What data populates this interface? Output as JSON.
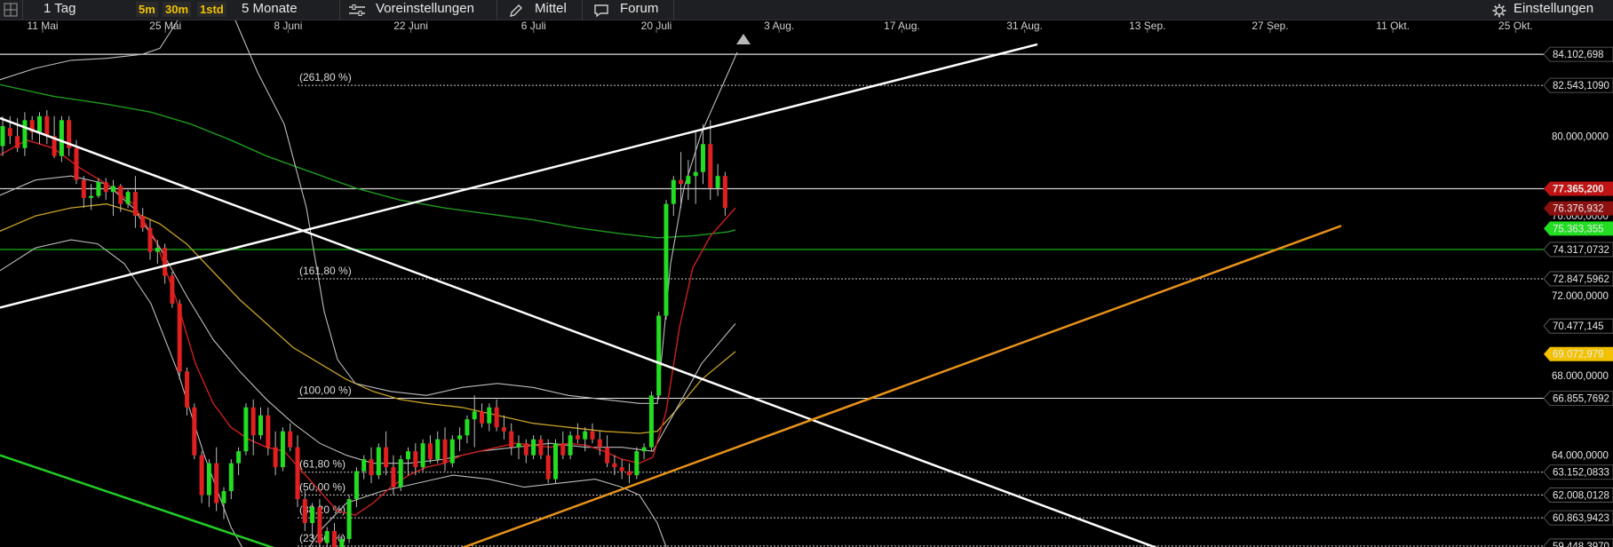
{
  "toolbar": {
    "period": "1 Tag",
    "intervals": [
      "5m",
      "30m",
      "1std"
    ],
    "range": "5 Monate",
    "presets": "Voreinstellungen",
    "tools": "Mittel",
    "forum": "Forum",
    "settings": "Einstellungen"
  },
  "colors": {
    "up": "#22dd22",
    "down": "#e02020",
    "fib": "#ffffff",
    "ma_red": "#cc1f1f",
    "ma_yellow": "#c9a227",
    "ma_green": "#1f9a1f",
    "bollinger": "#bdbdbd",
    "trend_white": "#ffffff",
    "trend_orange": "#e8921a",
    "trend_green": "#22cc22"
  },
  "chart_data": {
    "type": "candlestick",
    "x_ticks": [
      "11 Mai",
      "25 Mai",
      "8 Juni",
      "22 Juni",
      "6 Juli",
      "20 Juli",
      "3 Aug.",
      "17 Aug.",
      "31 Aug.",
      "13 Sep.",
      "27 Sep.",
      "11 Okt.",
      "25 Okt."
    ],
    "y_range": [
      59.4,
      85.8
    ],
    "y_ticks": [
      64,
      68,
      72,
      76,
      80
    ],
    "y_tick_labels": [
      "64.000,0000",
      "68.000,0000",
      "72.000,0000",
      "76.000,0000",
      "80.000,0000"
    ],
    "price_labels": [
      {
        "value": 84.102698,
        "text": "84.102,698"
      },
      {
        "value": 82.543109,
        "text": "82.543,1090"
      },
      {
        "value": 77.3652,
        "text": "77.365,200",
        "style": "current"
      },
      {
        "value": 76.376932,
        "text": "76.376,932",
        "style": "red"
      },
      {
        "value": 75.363355,
        "text": "75.363,355",
        "style": "green"
      },
      {
        "value": 74.317073,
        "text": "74.317,0732"
      },
      {
        "value": 72.847596,
        "text": "72.847,5962"
      },
      {
        "value": 70.477145,
        "text": "70.477,145"
      },
      {
        "value": 69.072979,
        "text": "69.072,979",
        "style": "yellow"
      },
      {
        "value": 66.855769,
        "text": "66.855,7692"
      },
      {
        "value": 63.152083,
        "text": "63.152,0833"
      },
      {
        "value": 62.008012,
        "text": "62.008,0128"
      },
      {
        "value": 60.863942,
        "text": "60.863,9423"
      },
      {
        "value": 59.448397,
        "text": "59.448,3970"
      }
    ],
    "fibonacci": [
      {
        "label": "(261,80 %)",
        "value": 82.543109
      },
      {
        "label": "(161,80 %)",
        "value": 72.847596
      },
      {
        "label": "(100,00 %)",
        "value": 66.855769
      },
      {
        "label": "(61,80 %)",
        "value": 63.152083
      },
      {
        "label": "(50,00 %)",
        "value": 62.008012
      },
      {
        "label": "(38,20 %)",
        "value": 60.863942
      },
      {
        "label": "(23,60 %)",
        "value": 59.448397
      }
    ],
    "horizontal_lines": [
      {
        "value": 84.102698,
        "color": "#dddddd"
      },
      {
        "value": 77.3652,
        "color": "#cfcfcf"
      },
      {
        "value": 74.317073,
        "color": "#18c018"
      }
    ],
    "candles": [
      [
        79.5,
        81.0,
        79.0,
        80.5
      ],
      [
        80.4,
        81.0,
        79.6,
        80.0
      ],
      [
        80.0,
        80.9,
        79.2,
        79.4
      ],
      [
        79.4,
        81.2,
        79.0,
        80.8
      ],
      [
        80.8,
        81.0,
        79.8,
        80.2
      ],
      [
        80.2,
        81.2,
        79.6,
        81.0
      ],
      [
        81.0,
        81.3,
        79.6,
        80.0
      ],
      [
        80.0,
        81.0,
        78.9,
        79.0
      ],
      [
        79.0,
        81.0,
        78.7,
        80.8
      ],
      [
        80.8,
        81.0,
        79.0,
        79.4
      ],
      [
        79.4,
        79.8,
        77.6,
        77.8
      ],
      [
        77.8,
        78.0,
        76.4,
        76.9
      ],
      [
        76.9,
        77.6,
        76.3,
        77.0
      ],
      [
        77.0,
        77.9,
        76.9,
        77.7
      ],
      [
        77.7,
        77.9,
        76.8,
        77.2
      ],
      [
        77.2,
        77.8,
        76.0,
        77.5
      ],
      [
        77.5,
        77.6,
        76.2,
        76.6
      ],
      [
        76.6,
        77.3,
        76.4,
        77.2
      ],
      [
        77.2,
        78.0,
        75.4,
        76.0
      ],
      [
        76.0,
        76.4,
        75.2,
        75.4
      ],
      [
        75.4,
        75.8,
        73.8,
        74.2
      ],
      [
        74.2,
        74.8,
        73.6,
        74.4
      ],
      [
        74.4,
        74.6,
        72.6,
        73.0
      ],
      [
        73.0,
        73.2,
        71.4,
        71.6
      ],
      [
        71.6,
        71.8,
        67.8,
        68.2
      ],
      [
        68.2,
        68.4,
        66.0,
        66.4
      ],
      [
        66.4,
        66.6,
        63.8,
        64.0
      ],
      [
        64.0,
        64.2,
        61.6,
        62.0
      ],
      [
        62.0,
        63.8,
        61.4,
        63.6
      ],
      [
        63.6,
        64.4,
        61.2,
        61.6
      ],
      [
        61.6,
        62.4,
        60.8,
        62.2
      ],
      [
        62.2,
        63.8,
        61.8,
        63.6
      ],
      [
        63.6,
        64.4,
        63.0,
        64.2
      ],
      [
        64.2,
        66.6,
        64.0,
        66.4
      ],
      [
        66.4,
        66.8,
        64.0,
        65.0
      ],
      [
        65.0,
        66.4,
        64.8,
        66.0
      ],
      [
        66.0,
        66.4,
        64.0,
        64.4
      ],
      [
        64.4,
        65.2,
        63.0,
        63.4
      ],
      [
        63.4,
        65.4,
        63.2,
        65.2
      ],
      [
        65.2,
        65.6,
        64.2,
        64.4
      ],
      [
        64.4,
        65.0,
        61.4,
        61.8
      ],
      [
        61.8,
        62.2,
        60.2,
        60.6
      ],
      [
        60.6,
        61.6,
        59.8,
        61.4
      ],
      [
        61.4,
        61.8,
        59.4,
        59.6
      ],
      [
        59.6,
        60.4,
        59.0,
        60.2
      ],
      [
        60.2,
        60.6,
        59.0,
        59.4
      ],
      [
        59.4,
        60.0,
        58.8,
        59.8
      ],
      [
        59.8,
        62.0,
        59.6,
        61.8
      ],
      [
        61.8,
        63.4,
        61.4,
        63.2
      ],
      [
        63.2,
        64.0,
        62.8,
        63.8
      ],
      [
        63.8,
        64.4,
        62.6,
        63.0
      ],
      [
        63.0,
        64.6,
        62.8,
        64.4
      ],
      [
        64.4,
        65.2,
        63.0,
        63.4
      ],
      [
        63.4,
        64.0,
        62.0,
        62.4
      ],
      [
        62.4,
        64.0,
        62.2,
        63.8
      ],
      [
        63.8,
        64.4,
        63.0,
        64.2
      ],
      [
        64.2,
        64.6,
        63.0,
        63.4
      ],
      [
        63.4,
        64.8,
        63.2,
        64.6
      ],
      [
        64.6,
        65.0,
        63.6,
        63.8
      ],
      [
        63.8,
        65.2,
        63.6,
        64.8
      ],
      [
        64.8,
        65.4,
        63.2,
        63.6
      ],
      [
        63.6,
        65.0,
        63.4,
        64.8
      ],
      [
        64.8,
        65.4,
        64.2,
        65.0
      ],
      [
        65.0,
        66.0,
        64.6,
        65.8
      ],
      [
        65.8,
        67.0,
        64.4,
        66.2
      ],
      [
        66.2,
        66.6,
        65.4,
        65.6
      ],
      [
        65.6,
        66.6,
        65.2,
        66.4
      ],
      [
        66.4,
        66.8,
        65.2,
        65.4
      ],
      [
        65.4,
        66.0,
        64.8,
        65.2
      ],
      [
        65.2,
        65.6,
        64.0,
        64.4
      ],
      [
        64.4,
        65.0,
        63.8,
        64.6
      ],
      [
        64.6,
        64.8,
        63.6,
        64.0
      ],
      [
        64.0,
        65.0,
        63.8,
        64.8
      ],
      [
        64.8,
        65.0,
        63.8,
        64.0
      ],
      [
        64.0,
        64.8,
        62.6,
        62.8
      ],
      [
        62.8,
        64.8,
        62.6,
        64.6
      ],
      [
        64.6,
        65.2,
        63.8,
        64.0
      ],
      [
        64.0,
        65.2,
        63.8,
        65.0
      ],
      [
        65.0,
        65.6,
        64.6,
        64.8
      ],
      [
        64.8,
        65.4,
        64.2,
        65.2
      ],
      [
        65.2,
        65.6,
        64.6,
        64.8
      ],
      [
        64.8,
        65.2,
        64.0,
        64.4
      ],
      [
        64.4,
        65.0,
        63.4,
        63.6
      ],
      [
        63.6,
        64.0,
        63.0,
        63.4
      ],
      [
        63.4,
        63.8,
        62.8,
        63.2
      ],
      [
        63.2,
        63.6,
        62.6,
        63.0
      ],
      [
        63.0,
        64.4,
        62.8,
        64.2
      ],
      [
        64.2,
        64.6,
        63.8,
        64.4
      ],
      [
        64.4,
        67.2,
        64.2,
        67.0
      ],
      [
        67.0,
        71.2,
        66.8,
        71.0
      ],
      [
        71.0,
        76.8,
        70.8,
        76.6
      ],
      [
        76.6,
        78.0,
        76.0,
        77.8
      ],
      [
        77.8,
        79.2,
        76.4,
        77.6
      ],
      [
        77.6,
        78.8,
        76.8,
        78.0
      ],
      [
        78.0,
        80.2,
        76.6,
        78.2
      ],
      [
        78.2,
        80.6,
        77.6,
        79.6
      ],
      [
        79.6,
        80.8,
        76.8,
        77.4
      ],
      [
        77.4,
        78.6,
        77.0,
        78.0
      ],
      [
        78.0,
        78.2,
        76.0,
        76.4
      ]
    ],
    "sma_green": [
      [
        -2,
        82.6
      ],
      [
        60,
        82.0
      ],
      [
        120,
        81.6
      ],
      [
        170,
        81.2
      ],
      [
        215,
        80.6
      ],
      [
        260,
        79.8
      ],
      [
        300,
        79.0
      ],
      [
        350,
        78.2
      ],
      [
        400,
        77.4
      ],
      [
        450,
        76.8
      ],
      [
        500,
        76.4
      ],
      [
        550,
        76.1
      ],
      [
        600,
        75.8
      ],
      [
        650,
        75.4
      ],
      [
        700,
        75.1
      ],
      [
        740,
        74.9
      ],
      [
        780,
        75.0
      ],
      [
        820,
        75.2
      ],
      [
        828,
        75.3
      ]
    ],
    "sma_yellow": [
      [
        -2,
        75.2
      ],
      [
        40,
        76.0
      ],
      [
        80,
        76.4
      ],
      [
        120,
        76.6
      ],
      [
        150,
        76.2
      ],
      [
        180,
        75.6
      ],
      [
        210,
        74.6
      ],
      [
        240,
        73.2
      ],
      [
        270,
        71.8
      ],
      [
        300,
        70.6
      ],
      [
        330,
        69.4
      ],
      [
        360,
        68.6
      ],
      [
        390,
        67.8
      ],
      [
        420,
        67.2
      ],
      [
        450,
        66.8
      ],
      [
        480,
        66.6
      ],
      [
        520,
        66.4
      ],
      [
        560,
        66.0
      ],
      [
        600,
        65.6
      ],
      [
        640,
        65.4
      ],
      [
        680,
        65.2
      ],
      [
        720,
        65.1
      ],
      [
        740,
        65.2
      ],
      [
        760,
        66.2
      ],
      [
        790,
        67.8
      ],
      [
        828,
        69.2
      ]
    ],
    "sma_red": [
      [
        -2,
        79.0
      ],
      [
        30,
        79.8
      ],
      [
        60,
        79.4
      ],
      [
        90,
        78.4
      ],
      [
        120,
        77.6
      ],
      [
        150,
        76.6
      ],
      [
        175,
        74.8
      ],
      [
        200,
        71.6
      ],
      [
        220,
        68.6
      ],
      [
        240,
        66.6
      ],
      [
        260,
        65.4
      ],
      [
        280,
        64.8
      ],
      [
        300,
        64.4
      ],
      [
        320,
        64.2
      ],
      [
        340,
        63.2
      ],
      [
        360,
        62.2
      ],
      [
        380,
        61.2
      ],
      [
        400,
        61.0
      ],
      [
        420,
        61.6
      ],
      [
        440,
        62.4
      ],
      [
        460,
        63.0
      ],
      [
        480,
        63.4
      ],
      [
        500,
        63.6
      ],
      [
        520,
        64.0
      ],
      [
        540,
        64.2
      ],
      [
        560,
        64.4
      ],
      [
        580,
        64.6
      ],
      [
        600,
        64.5
      ],
      [
        620,
        64.4
      ],
      [
        640,
        64.6
      ],
      [
        660,
        64.5
      ],
      [
        680,
        64.2
      ],
      [
        700,
        63.8
      ],
      [
        720,
        63.6
      ],
      [
        735,
        63.9
      ],
      [
        750,
        66.2
      ],
      [
        765,
        70.4
      ],
      [
        780,
        73.4
      ],
      [
        800,
        75.0
      ],
      [
        828,
        76.4
      ]
    ],
    "boll_upper": [
      [
        -2,
        82.8
      ],
      [
        40,
        83.4
      ],
      [
        80,
        83.8
      ],
      [
        120,
        83.9
      ],
      [
        160,
        84.1
      ],
      [
        180,
        84.4
      ],
      [
        200,
        85.8
      ]
    ],
    "boll_upper2": [
      [
        265,
        85.8
      ],
      [
        290,
        83.2
      ],
      [
        320,
        80.6
      ],
      [
        345,
        76.4
      ],
      [
        365,
        71.2
      ],
      [
        380,
        68.8
      ],
      [
        400,
        67.6
      ],
      [
        440,
        67.2
      ],
      [
        480,
        67.0
      ],
      [
        520,
        67.4
      ],
      [
        560,
        67.6
      ],
      [
        600,
        67.4
      ],
      [
        640,
        67.0
      ],
      [
        680,
        66.8
      ],
      [
        720,
        66.6
      ],
      [
        740,
        66.6
      ],
      [
        755,
        73.6
      ],
      [
        770,
        77.4
      ],
      [
        790,
        80.2
      ],
      [
        810,
        82.2
      ],
      [
        830,
        84.2
      ]
    ],
    "boll_mid": [
      [
        -2,
        77.0
      ],
      [
        40,
        77.8
      ],
      [
        80,
        78.0
      ],
      [
        120,
        77.6
      ],
      [
        150,
        76.4
      ],
      [
        180,
        74.4
      ],
      [
        210,
        72.0
      ],
      [
        240,
        69.8
      ],
      [
        270,
        68.2
      ],
      [
        300,
        66.8
      ],
      [
        330,
        65.6
      ],
      [
        360,
        64.6
      ],
      [
        390,
        64.0
      ],
      [
        420,
        63.6
      ],
      [
        460,
        63.6
      ],
      [
        500,
        63.8
      ],
      [
        540,
        64.2
      ],
      [
        580,
        64.4
      ],
      [
        620,
        64.6
      ],
      [
        660,
        64.4
      ],
      [
        700,
        64.4
      ],
      [
        735,
        64.2
      ],
      [
        760,
        66.2
      ],
      [
        790,
        68.6
      ],
      [
        828,
        70.6
      ]
    ],
    "boll_lower": [
      [
        -2,
        73.2
      ],
      [
        40,
        74.4
      ],
      [
        80,
        74.8
      ],
      [
        110,
        74.6
      ],
      [
        140,
        73.6
      ],
      [
        170,
        71.6
      ],
      [
        200,
        68.2
      ],
      [
        230,
        64.0
      ],
      [
        260,
        60.4
      ],
      [
        280,
        58.8
      ]
    ],
    "boll_lower2": [
      [
        340,
        58.8
      ],
      [
        360,
        60.2
      ],
      [
        390,
        61.6
      ],
      [
        430,
        62.2
      ],
      [
        470,
        62.6
      ],
      [
        510,
        63.0
      ],
      [
        550,
        62.8
      ],
      [
        590,
        62.4
      ],
      [
        630,
        62.6
      ],
      [
        670,
        62.8
      ],
      [
        700,
        62.4
      ],
      [
        720,
        62.0
      ],
      [
        740,
        60.6
      ],
      [
        755,
        58.8
      ]
    ],
    "trendlines": [
      {
        "color": "#ffffff",
        "from": [
          0,
          71.4
        ],
        "to": [
          1168,
          84.6
        ],
        "width": 2.5
      },
      {
        "color": "#ffffff",
        "from": [
          0,
          80.9
        ],
        "to": [
          1360,
          58.4
        ],
        "width": 2.5
      },
      {
        "color": "#e8921a",
        "from": [
          480,
          58.7
        ],
        "to": [
          1510,
          75.5
        ],
        "width": 2.5
      },
      {
        "color": "#22cc22",
        "from": [
          0,
          64.0
        ],
        "to": [
          345,
          58.8
        ],
        "width": 2.5
      }
    ]
  }
}
